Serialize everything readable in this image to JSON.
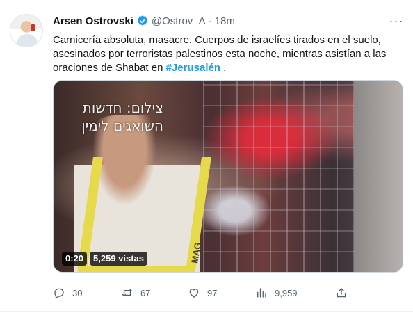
{
  "tweet": {
    "author_name": "Arsen Ostrovski",
    "handle": "@Ostrov_A",
    "separator": "·",
    "time": "18m",
    "more_label": "···",
    "text_prefix": "Carnicería absoluta, masacre. Cuerpos de israelíes tirados en el suelo, asesinados por terroristas palestinos esta noche, mientras asistían a las oraciones de Shabat en ",
    "hashtag": "#Jerusalén",
    "text_suffix": " ."
  },
  "media": {
    "watermark_line1": "צילום: חדשות",
    "watermark_line2": "השואגים לימין",
    "vest_text": "MAG",
    "duration": "0:20",
    "views": "5,259 vistas"
  },
  "actions": {
    "replies": "30",
    "retweets": "67",
    "likes": "97",
    "views": "9,959"
  },
  "colors": {
    "accent": "#1d9bf0",
    "secondary_text": "#536471"
  }
}
